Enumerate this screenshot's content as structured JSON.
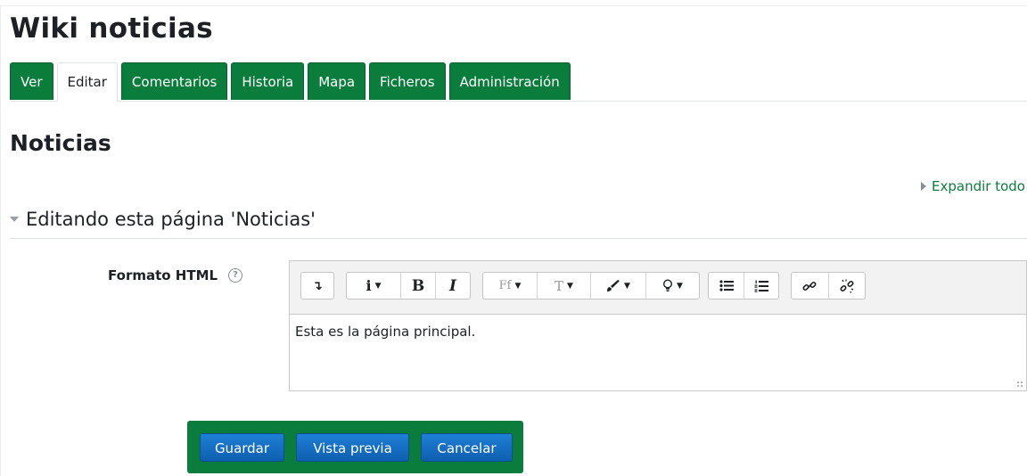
{
  "wiki": {
    "title": "Wiki noticias"
  },
  "tabs": [
    {
      "label": "Ver"
    },
    {
      "label": "Editar"
    },
    {
      "label": "Comentarios"
    },
    {
      "label": "Historia"
    },
    {
      "label": "Mapa"
    },
    {
      "label": "Ficheros"
    },
    {
      "label": "Administración"
    }
  ],
  "active_tab": "Editar",
  "page": {
    "name": "Noticias"
  },
  "expand_all": "Expandir todo",
  "section": {
    "title": "Editando esta página 'Noticias'"
  },
  "field": {
    "label": "Formato HTML",
    "help": "?"
  },
  "toolbar": {
    "collapse": "↴",
    "info": "i",
    "bold": "B",
    "italic": "I",
    "font_family": "Ff",
    "font_size": "T",
    "caret": "▼"
  },
  "editor": {
    "content": "Esta es la página principal."
  },
  "buttons": {
    "save": "Guardar",
    "preview": "Vista previa",
    "cancel": "Cancelar"
  },
  "colors": {
    "brand_green": "#0a7d3c",
    "button_blue": "#0f6cbf",
    "link_green": "#0a7d3c"
  }
}
